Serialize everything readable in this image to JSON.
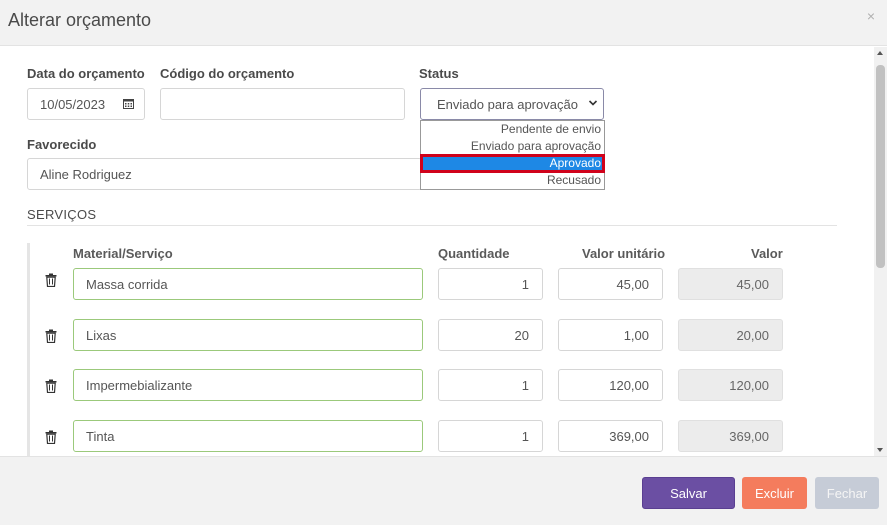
{
  "dialog": {
    "title": "Alterar orçamento",
    "close_label": "×"
  },
  "form": {
    "date_label": "Data do orçamento",
    "date_value": "10/05/2023",
    "code_label": "Código do orçamento",
    "code_value": "",
    "status_label": "Status",
    "status_value": "Enviado para aprovação",
    "status_options": [
      "Pendente de envio",
      "Enviado para aprovação",
      "Aprovado",
      "Recusado"
    ],
    "status_highlighted": "Aprovado",
    "payee_label": "Favorecido",
    "payee_value": "Aline Rodriguez"
  },
  "services": {
    "section_title": "SERVIÇOS",
    "columns": [
      "Material/Serviço",
      "Quantidade",
      "Valor unitário",
      "Valor"
    ],
    "rows": [
      {
        "material": "Massa corrida",
        "quantity": "1",
        "unit_value": "45,00",
        "value": "45,00"
      },
      {
        "material": "Lixas",
        "quantity": "20",
        "unit_value": "1,00",
        "value": "20,00"
      },
      {
        "material": "Impermebializante",
        "quantity": "1",
        "unit_value": "120,00",
        "value": "120,00"
      },
      {
        "material": "Tinta",
        "quantity": "1",
        "unit_value": "369,00",
        "value": "369,00"
      }
    ]
  },
  "footer": {
    "save_label": "Salvar",
    "delete_label": "Excluir",
    "close_label": "Fechar"
  },
  "colors": {
    "save": "#6b4fa3",
    "delete": "#f47c5d",
    "close": "#c6ccd7",
    "highlight": "#1e88e5",
    "highlight_border": "#d0021b",
    "material_border": "#9bc97b"
  },
  "icons": [
    "calendar-icon",
    "chevron-down-icon",
    "trash-icon",
    "close-icon"
  ]
}
